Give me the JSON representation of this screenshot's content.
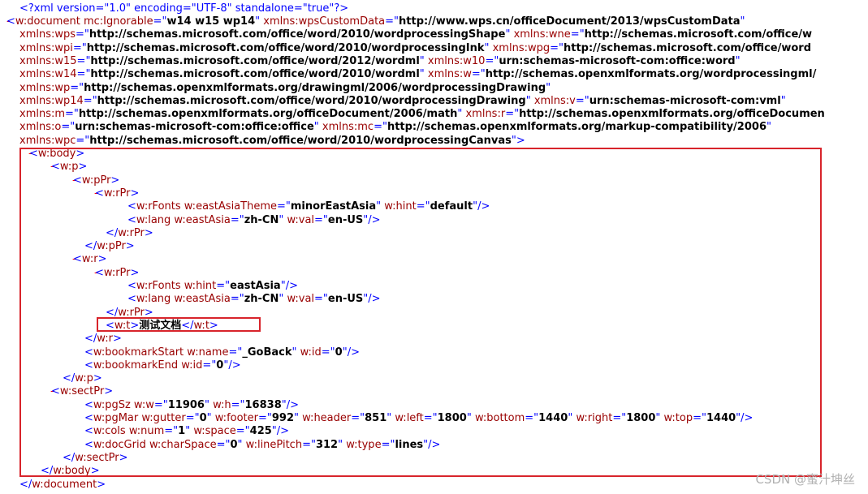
{
  "xml_declaration": "<?xml version=\"1.0\" encoding=\"UTF-8\" standalone=\"true\"?>",
  "lines": [
    {
      "marker": "-",
      "parts": [
        {
          "t": "br",
          "v": "<"
        },
        {
          "t": "tag",
          "v": "w:document "
        },
        {
          "t": "attr",
          "v": "mc:Ignorable"
        },
        {
          "t": "eq",
          "v": "=\""
        },
        {
          "t": "val",
          "v": "w14 w15 wp14"
        },
        {
          "t": "eq",
          "v": "\" "
        },
        {
          "t": "attr",
          "v": "xmlns:wpsCustomData"
        },
        {
          "t": "eq",
          "v": "=\""
        },
        {
          "t": "val",
          "v": "http://www.wps.cn/officeDocument/2013/wpsCustomData"
        },
        {
          "t": "eq",
          "v": "\""
        }
      ]
    },
    {
      "parts": [
        {
          "t": "attr",
          "v": "xmlns:wps"
        },
        {
          "t": "eq",
          "v": "=\""
        },
        {
          "t": "val",
          "v": "http://schemas.microsoft.com/office/word/2010/wordprocessingShape"
        },
        {
          "t": "eq",
          "v": "\" "
        },
        {
          "t": "attr",
          "v": "xmlns:wne"
        },
        {
          "t": "eq",
          "v": "=\""
        },
        {
          "t": "val",
          "v": "http://schemas.microsoft.com/office/w"
        }
      ]
    },
    {
      "parts": [
        {
          "t": "attr",
          "v": "xmlns:wpi"
        },
        {
          "t": "eq",
          "v": "=\""
        },
        {
          "t": "val",
          "v": "http://schemas.microsoft.com/office/word/2010/wordprocessingInk"
        },
        {
          "t": "eq",
          "v": "\" "
        },
        {
          "t": "attr",
          "v": "xmlns:wpg"
        },
        {
          "t": "eq",
          "v": "=\""
        },
        {
          "t": "val",
          "v": "http://schemas.microsoft.com/office/word"
        }
      ]
    },
    {
      "parts": [
        {
          "t": "attr",
          "v": "xmlns:w15"
        },
        {
          "t": "eq",
          "v": "=\""
        },
        {
          "t": "val",
          "v": "http://schemas.microsoft.com/office/word/2012/wordml"
        },
        {
          "t": "eq",
          "v": "\" "
        },
        {
          "t": "attr",
          "v": "xmlns:w10"
        },
        {
          "t": "eq",
          "v": "=\""
        },
        {
          "t": "val",
          "v": "urn:schemas-microsoft-com:office:word"
        },
        {
          "t": "eq",
          "v": "\""
        }
      ]
    },
    {
      "parts": [
        {
          "t": "attr",
          "v": "xmlns:w14"
        },
        {
          "t": "eq",
          "v": "=\""
        },
        {
          "t": "val",
          "v": "http://schemas.microsoft.com/office/word/2010/wordml"
        },
        {
          "t": "eq",
          "v": "\" "
        },
        {
          "t": "attr",
          "v": "xmlns:w"
        },
        {
          "t": "eq",
          "v": "=\""
        },
        {
          "t": "val",
          "v": "http://schemas.openxmlformats.org/wordprocessingml/"
        }
      ]
    },
    {
      "parts": [
        {
          "t": "attr",
          "v": "xmlns:wp"
        },
        {
          "t": "eq",
          "v": "=\""
        },
        {
          "t": "val",
          "v": "http://schemas.openxmlformats.org/drawingml/2006/wordprocessingDrawing"
        },
        {
          "t": "eq",
          "v": "\""
        }
      ]
    },
    {
      "parts": [
        {
          "t": "attr",
          "v": "xmlns:wp14"
        },
        {
          "t": "eq",
          "v": "=\""
        },
        {
          "t": "val",
          "v": "http://schemas.microsoft.com/office/word/2010/wordprocessingDrawing"
        },
        {
          "t": "eq",
          "v": "\" "
        },
        {
          "t": "attr",
          "v": "xmlns:v"
        },
        {
          "t": "eq",
          "v": "=\""
        },
        {
          "t": "val",
          "v": "urn:schemas-microsoft-com:vml"
        },
        {
          "t": "eq",
          "v": "\""
        }
      ]
    },
    {
      "parts": [
        {
          "t": "attr",
          "v": "xmlns:m"
        },
        {
          "t": "eq",
          "v": "=\""
        },
        {
          "t": "val",
          "v": "http://schemas.openxmlformats.org/officeDocument/2006/math"
        },
        {
          "t": "eq",
          "v": "\" "
        },
        {
          "t": "attr",
          "v": "xmlns:r"
        },
        {
          "t": "eq",
          "v": "=\""
        },
        {
          "t": "val",
          "v": "http://schemas.openxmlformats.org/officeDocumen"
        }
      ]
    },
    {
      "parts": [
        {
          "t": "attr",
          "v": "xmlns:o"
        },
        {
          "t": "eq",
          "v": "=\""
        },
        {
          "t": "val",
          "v": "urn:schemas-microsoft-com:office:office"
        },
        {
          "t": "eq",
          "v": "\" "
        },
        {
          "t": "attr",
          "v": "xmlns:mc"
        },
        {
          "t": "eq",
          "v": "=\""
        },
        {
          "t": "val",
          "v": "http://schemas.openxmlformats.org/markup-compatibility/2006"
        },
        {
          "t": "eq",
          "v": "\""
        }
      ]
    },
    {
      "parts": [
        {
          "t": "attr",
          "v": "xmlns:wpc"
        },
        {
          "t": "eq",
          "v": "=\""
        },
        {
          "t": "val",
          "v": "http://schemas.microsoft.com/office/word/2010/wordprocessingCanvas"
        },
        {
          "t": "eq",
          "v": "\""
        },
        {
          "t": "br",
          "v": ">"
        }
      ]
    },
    {
      "marker": "-",
      "parts": [
        {
          "t": "br",
          "v": "<"
        },
        {
          "t": "tag",
          "v": "w:body"
        },
        {
          "t": "br",
          "v": ">"
        }
      ]
    },
    {
      "marker": "-",
      "parts": [
        {
          "t": "br",
          "v": "<"
        },
        {
          "t": "tag",
          "v": "w:p"
        },
        {
          "t": "br",
          "v": ">"
        }
      ]
    },
    {
      "marker": "-",
      "parts": [
        {
          "t": "br",
          "v": "<"
        },
        {
          "t": "tag",
          "v": "w:pPr"
        },
        {
          "t": "br",
          "v": ">"
        }
      ]
    },
    {
      "marker": "-",
      "parts": [
        {
          "t": "br",
          "v": "<"
        },
        {
          "t": "tag",
          "v": "w:rPr"
        },
        {
          "t": "br",
          "v": ">"
        }
      ]
    },
    {
      "parts": [
        {
          "t": "br",
          "v": "<"
        },
        {
          "t": "tag",
          "v": "w:rFonts "
        },
        {
          "t": "attr",
          "v": "w:eastAsiaTheme"
        },
        {
          "t": "eq",
          "v": "=\""
        },
        {
          "t": "val",
          "v": "minorEastAsia"
        },
        {
          "t": "eq",
          "v": "\" "
        },
        {
          "t": "attr",
          "v": "w:hint"
        },
        {
          "t": "eq",
          "v": "=\""
        },
        {
          "t": "val",
          "v": "default"
        },
        {
          "t": "eq",
          "v": "\""
        },
        {
          "t": "br",
          "v": "/>"
        }
      ]
    },
    {
      "parts": [
        {
          "t": "br",
          "v": "<"
        },
        {
          "t": "tag",
          "v": "w:lang "
        },
        {
          "t": "attr",
          "v": "w:eastAsia"
        },
        {
          "t": "eq",
          "v": "=\""
        },
        {
          "t": "val",
          "v": "zh-CN"
        },
        {
          "t": "eq",
          "v": "\" "
        },
        {
          "t": "attr",
          "v": "w:val"
        },
        {
          "t": "eq",
          "v": "=\""
        },
        {
          "t": "val",
          "v": "en-US"
        },
        {
          "t": "eq",
          "v": "\""
        },
        {
          "t": "br",
          "v": "/>"
        }
      ]
    },
    {
      "parts": [
        {
          "t": "br",
          "v": "</"
        },
        {
          "t": "tag",
          "v": "w:rPr"
        },
        {
          "t": "br",
          "v": ">"
        }
      ]
    },
    {
      "parts": [
        {
          "t": "br",
          "v": "</"
        },
        {
          "t": "tag",
          "v": "w:pPr"
        },
        {
          "t": "br",
          "v": ">"
        }
      ]
    },
    {
      "marker": "-",
      "parts": [
        {
          "t": "br",
          "v": "<"
        },
        {
          "t": "tag",
          "v": "w:r"
        },
        {
          "t": "br",
          "v": ">"
        }
      ]
    },
    {
      "marker": "-",
      "parts": [
        {
          "t": "br",
          "v": "<"
        },
        {
          "t": "tag",
          "v": "w:rPr"
        },
        {
          "t": "br",
          "v": ">"
        }
      ]
    },
    {
      "parts": [
        {
          "t": "br",
          "v": "<"
        },
        {
          "t": "tag",
          "v": "w:rFonts "
        },
        {
          "t": "attr",
          "v": "w:hint"
        },
        {
          "t": "eq",
          "v": "=\""
        },
        {
          "t": "val",
          "v": "eastAsia"
        },
        {
          "t": "eq",
          "v": "\""
        },
        {
          "t": "br",
          "v": "/>"
        }
      ]
    },
    {
      "parts": [
        {
          "t": "br",
          "v": "<"
        },
        {
          "t": "tag",
          "v": "w:lang "
        },
        {
          "t": "attr",
          "v": "w:eastAsia"
        },
        {
          "t": "eq",
          "v": "=\""
        },
        {
          "t": "val",
          "v": "zh-CN"
        },
        {
          "t": "eq",
          "v": "\" "
        },
        {
          "t": "attr",
          "v": "w:val"
        },
        {
          "t": "eq",
          "v": "=\""
        },
        {
          "t": "val",
          "v": "en-US"
        },
        {
          "t": "eq",
          "v": "\""
        },
        {
          "t": "br",
          "v": "/>"
        }
      ]
    },
    {
      "parts": [
        {
          "t": "br",
          "v": "</"
        },
        {
          "t": "tag",
          "v": "w:rPr"
        },
        {
          "t": "br",
          "v": ">"
        }
      ]
    },
    {
      "parts": [
        {
          "t": "br",
          "v": "<"
        },
        {
          "t": "tag",
          "v": "w:t"
        },
        {
          "t": "br",
          "v": ">"
        },
        {
          "t": "txt",
          "v": "测试文档"
        },
        {
          "t": "br",
          "v": "</"
        },
        {
          "t": "tag",
          "v": "w:t"
        },
        {
          "t": "br",
          "v": ">"
        }
      ]
    },
    {
      "parts": [
        {
          "t": "br",
          "v": "</"
        },
        {
          "t": "tag",
          "v": "w:r"
        },
        {
          "t": "br",
          "v": ">"
        }
      ]
    },
    {
      "parts": [
        {
          "t": "br",
          "v": "<"
        },
        {
          "t": "tag",
          "v": "w:bookmarkStart "
        },
        {
          "t": "attr",
          "v": "w:name"
        },
        {
          "t": "eq",
          "v": "=\""
        },
        {
          "t": "val",
          "v": "_GoBack"
        },
        {
          "t": "eq",
          "v": "\" "
        },
        {
          "t": "attr",
          "v": "w:id"
        },
        {
          "t": "eq",
          "v": "=\""
        },
        {
          "t": "val",
          "v": "0"
        },
        {
          "t": "eq",
          "v": "\""
        },
        {
          "t": "br",
          "v": "/>"
        }
      ]
    },
    {
      "parts": [
        {
          "t": "br",
          "v": "<"
        },
        {
          "t": "tag",
          "v": "w:bookmarkEnd "
        },
        {
          "t": "attr",
          "v": "w:id"
        },
        {
          "t": "eq",
          "v": "=\""
        },
        {
          "t": "val",
          "v": "0"
        },
        {
          "t": "eq",
          "v": "\""
        },
        {
          "t": "br",
          "v": "/>"
        }
      ]
    },
    {
      "parts": [
        {
          "t": "br",
          "v": "</"
        },
        {
          "t": "tag",
          "v": "w:p"
        },
        {
          "t": "br",
          "v": ">"
        }
      ]
    },
    {
      "marker": "-",
      "parts": [
        {
          "t": "br",
          "v": "<"
        },
        {
          "t": "tag",
          "v": "w:sectPr"
        },
        {
          "t": "br",
          "v": ">"
        }
      ]
    },
    {
      "parts": [
        {
          "t": "br",
          "v": "<"
        },
        {
          "t": "tag",
          "v": "w:pgSz "
        },
        {
          "t": "attr",
          "v": "w:w"
        },
        {
          "t": "eq",
          "v": "=\""
        },
        {
          "t": "val",
          "v": "11906"
        },
        {
          "t": "eq",
          "v": "\" "
        },
        {
          "t": "attr",
          "v": "w:h"
        },
        {
          "t": "eq",
          "v": "=\""
        },
        {
          "t": "val",
          "v": "16838"
        },
        {
          "t": "eq",
          "v": "\""
        },
        {
          "t": "br",
          "v": "/>"
        }
      ]
    },
    {
      "parts": [
        {
          "t": "br",
          "v": "<"
        },
        {
          "t": "tag",
          "v": "w:pgMar "
        },
        {
          "t": "attr",
          "v": "w:gutter"
        },
        {
          "t": "eq",
          "v": "=\""
        },
        {
          "t": "val",
          "v": "0"
        },
        {
          "t": "eq",
          "v": "\" "
        },
        {
          "t": "attr",
          "v": "w:footer"
        },
        {
          "t": "eq",
          "v": "=\""
        },
        {
          "t": "val",
          "v": "992"
        },
        {
          "t": "eq",
          "v": "\" "
        },
        {
          "t": "attr",
          "v": "w:header"
        },
        {
          "t": "eq",
          "v": "=\""
        },
        {
          "t": "val",
          "v": "851"
        },
        {
          "t": "eq",
          "v": "\" "
        },
        {
          "t": "attr",
          "v": "w:left"
        },
        {
          "t": "eq",
          "v": "=\""
        },
        {
          "t": "val",
          "v": "1800"
        },
        {
          "t": "eq",
          "v": "\" "
        },
        {
          "t": "attr",
          "v": "w:bottom"
        },
        {
          "t": "eq",
          "v": "=\""
        },
        {
          "t": "val",
          "v": "1440"
        },
        {
          "t": "eq",
          "v": "\" "
        },
        {
          "t": "attr",
          "v": "w:right"
        },
        {
          "t": "eq",
          "v": "=\""
        },
        {
          "t": "val",
          "v": "1800"
        },
        {
          "t": "eq",
          "v": "\" "
        },
        {
          "t": "attr",
          "v": "w:top"
        },
        {
          "t": "eq",
          "v": "=\""
        },
        {
          "t": "val",
          "v": "1440"
        },
        {
          "t": "eq",
          "v": "\""
        },
        {
          "t": "br",
          "v": "/>"
        }
      ]
    },
    {
      "parts": [
        {
          "t": "br",
          "v": "<"
        },
        {
          "t": "tag",
          "v": "w:cols "
        },
        {
          "t": "attr",
          "v": "w:num"
        },
        {
          "t": "eq",
          "v": "=\""
        },
        {
          "t": "val",
          "v": "1"
        },
        {
          "t": "eq",
          "v": "\" "
        },
        {
          "t": "attr",
          "v": "w:space"
        },
        {
          "t": "eq",
          "v": "=\""
        },
        {
          "t": "val",
          "v": "425"
        },
        {
          "t": "eq",
          "v": "\""
        },
        {
          "t": "br",
          "v": "/>"
        }
      ]
    },
    {
      "parts": [
        {
          "t": "br",
          "v": "<"
        },
        {
          "t": "tag",
          "v": "w:docGrid "
        },
        {
          "t": "attr",
          "v": "w:charSpace"
        },
        {
          "t": "eq",
          "v": "=\""
        },
        {
          "t": "val",
          "v": "0"
        },
        {
          "t": "eq",
          "v": "\" "
        },
        {
          "t": "attr",
          "v": "w:linePitch"
        },
        {
          "t": "eq",
          "v": "=\""
        },
        {
          "t": "val",
          "v": "312"
        },
        {
          "t": "eq",
          "v": "\" "
        },
        {
          "t": "attr",
          "v": "w:type"
        },
        {
          "t": "eq",
          "v": "=\""
        },
        {
          "t": "val",
          "v": "lines"
        },
        {
          "t": "eq",
          "v": "\""
        },
        {
          "t": "br",
          "v": "/>"
        }
      ]
    },
    {
      "parts": [
        {
          "t": "br",
          "v": "</"
        },
        {
          "t": "tag",
          "v": "w:sectPr"
        },
        {
          "t": "br",
          "v": ">"
        }
      ]
    },
    {
      "parts": [
        {
          "t": "br",
          "v": "</"
        },
        {
          "t": "tag",
          "v": "w:body"
        },
        {
          "t": "br",
          "v": ">"
        }
      ]
    },
    {
      "parts": [
        {
          "t": "br",
          "v": "</"
        },
        {
          "t": "tag",
          "v": "w:document"
        },
        {
          "t": "br",
          "v": ">"
        }
      ]
    }
  ],
  "watermark": "CSDN @蜜汁坤丝",
  "colors": {
    "marker": "#ff0000",
    "bracket": "#0000ff",
    "element": "#990000",
    "value": "#000000",
    "highlight_box": "#d8242b"
  }
}
